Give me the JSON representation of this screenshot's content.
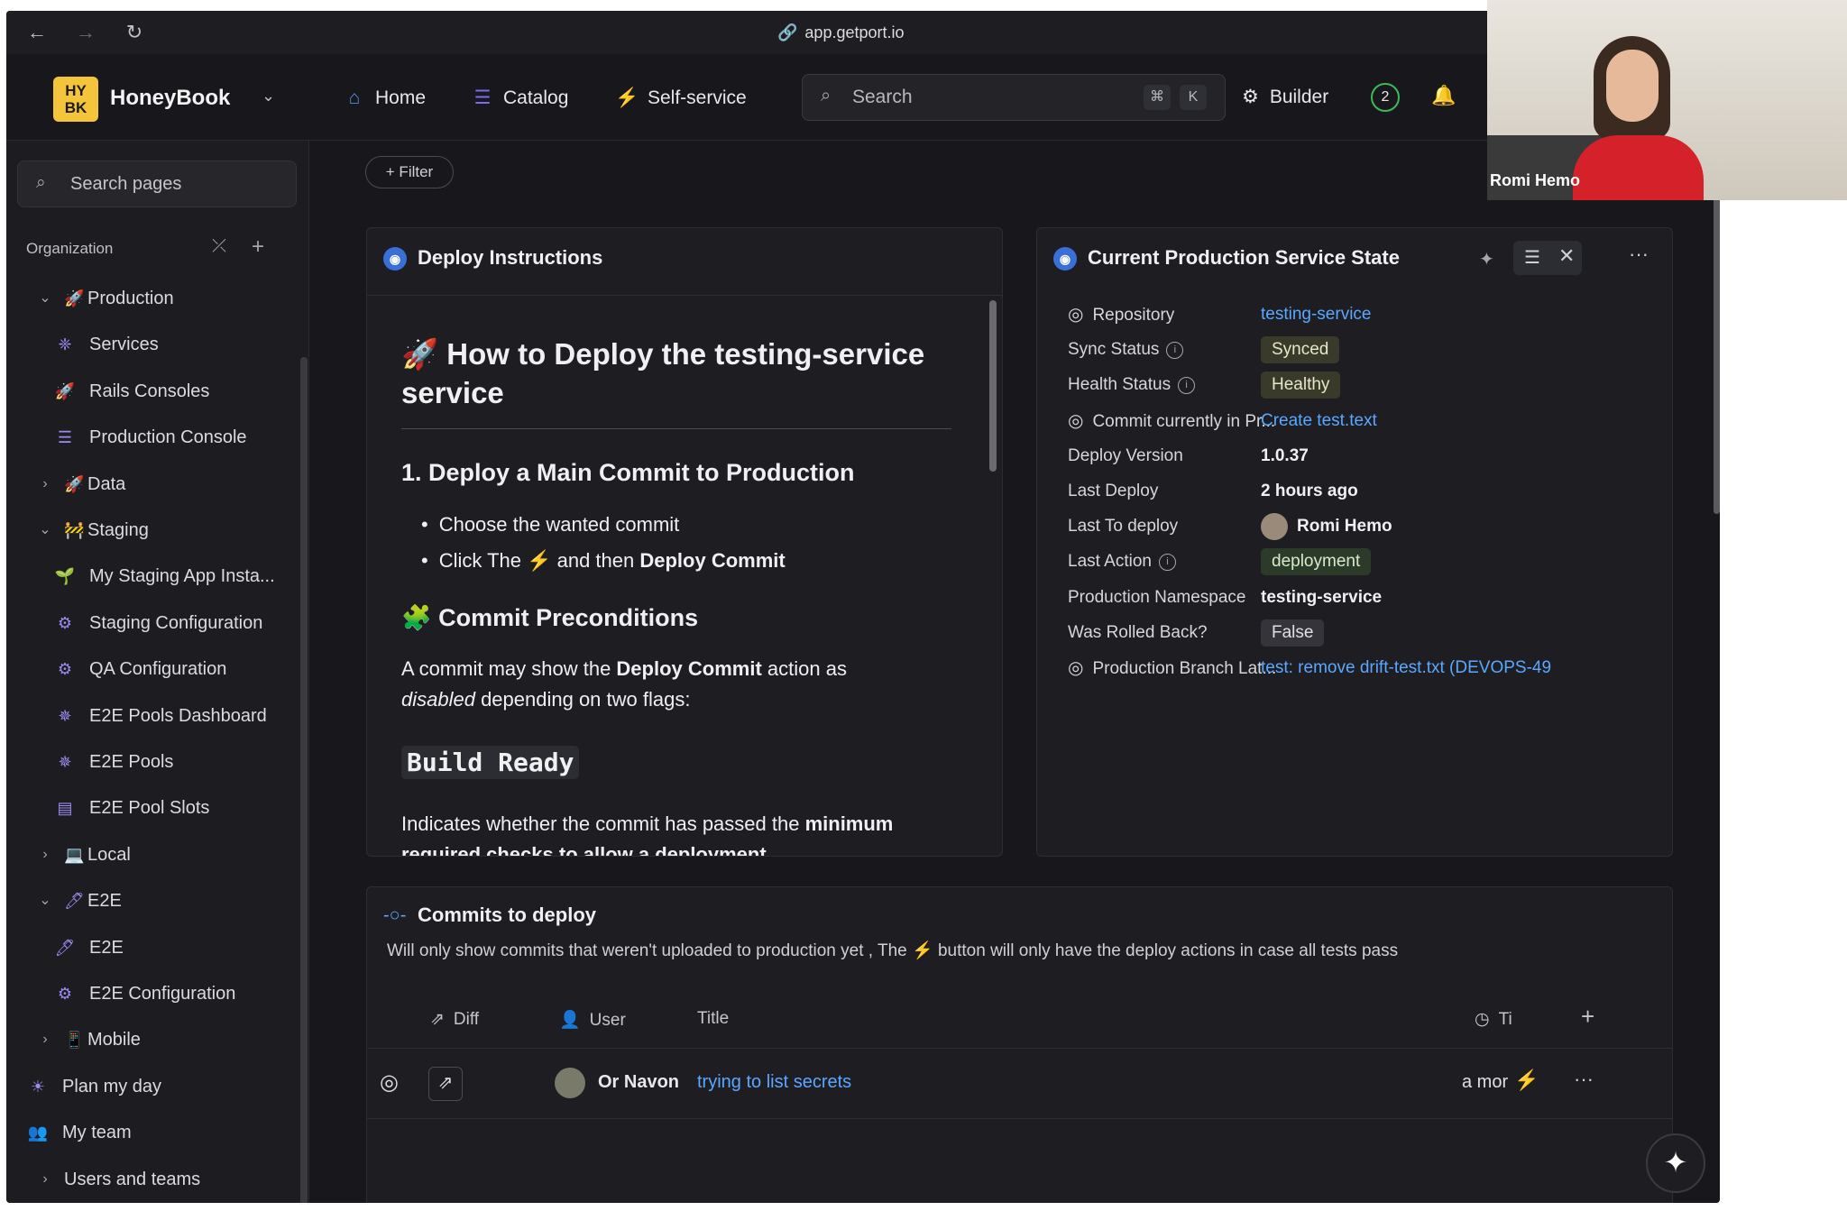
{
  "browser": {
    "url": "app.getport.io"
  },
  "topnav": {
    "logo_text": "HY BK",
    "org_name": "HoneyBook",
    "items": [
      {
        "label": "Home",
        "icon": "home-icon"
      },
      {
        "label": "Catalog",
        "icon": "list-icon"
      },
      {
        "label": "Self-service",
        "icon": "bolt-icon"
      }
    ],
    "search_placeholder": "Search",
    "search_shortcut": [
      "⌘",
      "K"
    ],
    "builder_label": "Builder",
    "badge_count": "2"
  },
  "sidebar": {
    "search_placeholder": "Search pages",
    "section_label": "Organization",
    "items": [
      {
        "label": "Production",
        "chevron": "⌄",
        "icon": "🚀",
        "level": 0
      },
      {
        "label": "Services",
        "icon": "❈",
        "level": 1
      },
      {
        "label": "Rails Consoles",
        "icon": "🚀",
        "level": 1
      },
      {
        "label": "Production Console",
        "icon": "☰",
        "level": 1
      },
      {
        "label": "Data",
        "chevron": "›",
        "icon": "🚀",
        "level": 0
      },
      {
        "label": "Staging",
        "chevron": "⌄",
        "icon": "🚧",
        "level": 0
      },
      {
        "label": "My Staging App Insta...",
        "icon": "🌱",
        "level": 1
      },
      {
        "label": "Staging Configuration",
        "icon": "⚙",
        "level": 1
      },
      {
        "label": "QA Configuration",
        "icon": "⚙",
        "level": 1
      },
      {
        "label": "E2E Pools Dashboard",
        "icon": "✵",
        "level": 1
      },
      {
        "label": "E2E Pools",
        "icon": "✵",
        "level": 1
      },
      {
        "label": "E2E Pool Slots",
        "icon": "▤",
        "level": 1
      },
      {
        "label": "Local",
        "chevron": "›",
        "icon": "💻",
        "level": 0
      },
      {
        "label": "E2E",
        "chevron": "⌄",
        "icon": "🖊",
        "level": 0
      },
      {
        "label": "E2E",
        "icon": "🖊",
        "level": 1
      },
      {
        "label": "E2E Configuration",
        "icon": "⚙",
        "level": 1
      },
      {
        "label": "Mobile",
        "chevron": "›",
        "icon": "📱",
        "level": 0
      },
      {
        "label": "Plan my day",
        "icon": "☀",
        "level": -1
      },
      {
        "label": "My team",
        "icon": "👥",
        "level": -1
      },
      {
        "label": "Users and teams",
        "chevron": "›",
        "icon": "",
        "level": -2
      }
    ]
  },
  "main": {
    "filter_label": "+ Filter",
    "deploy_card": {
      "title": "Deploy Instructions",
      "heading": "🚀 How to Deploy the testing-service service",
      "section1_title": "1. Deploy a Main Commit to Production",
      "bullet1": "Choose the wanted commit",
      "bullet2_prefix": "Click The ⚡ and then ",
      "bullet2_bold": "Deploy Commit",
      "section2_title": "🧩 Commit Preconditions",
      "para1_a": "A commit may show the ",
      "para1_b": "Deploy Commit",
      "para1_c": " action as",
      "para1_d": "disabled",
      "para1_e": " depending on two flags:",
      "code1": "Build Ready",
      "para2_a": "Indicates whether the commit has passed the ",
      "para2_b": "minimum",
      "para2_c": "required checks to allow a deployment"
    },
    "state_card": {
      "title": "Current Production Service State",
      "rows": [
        {
          "label": "Repository",
          "value": "testing-service"
        },
        {
          "label": "Sync Status",
          "value": "Synced"
        },
        {
          "label": "Health Status",
          "value": "Healthy"
        },
        {
          "label": "Commit currently in Pr...",
          "value": "Create test.text"
        },
        {
          "label": "Deploy Version",
          "value": "1.0.37"
        },
        {
          "label": "Last Deploy",
          "value": "2 hours ago"
        },
        {
          "label": "Last To deploy",
          "value": "Romi Hemo"
        },
        {
          "label": "Last Action",
          "value": "deployment"
        },
        {
          "label": "Production Namespace",
          "value": "testing-service"
        },
        {
          "label": "Was Rolled Back?",
          "value": "False"
        },
        {
          "label": "Production Branch Lat...",
          "value": "test: remove drift-test.txt (DEVOPS-49"
        }
      ]
    },
    "commits_card": {
      "title": "Commits to deploy",
      "subtitle_a": "Will only show commits that weren't uploaded to production yet , The ",
      "subtitle_b": "⚡",
      "subtitle_c": " button will only have the deploy actions in case all tests pass",
      "columns": [
        "Diff",
        "User",
        "Title",
        "Ti"
      ],
      "rows": [
        {
          "user": "Or Navon",
          "title": "trying to list secrets",
          "time": "a mor"
        }
      ]
    }
  },
  "webcam": {
    "name": "Romi Hemo"
  },
  "colors": {
    "accent": "#5aa8ff",
    "logo": "#f4c43a",
    "background": "#18181c"
  }
}
